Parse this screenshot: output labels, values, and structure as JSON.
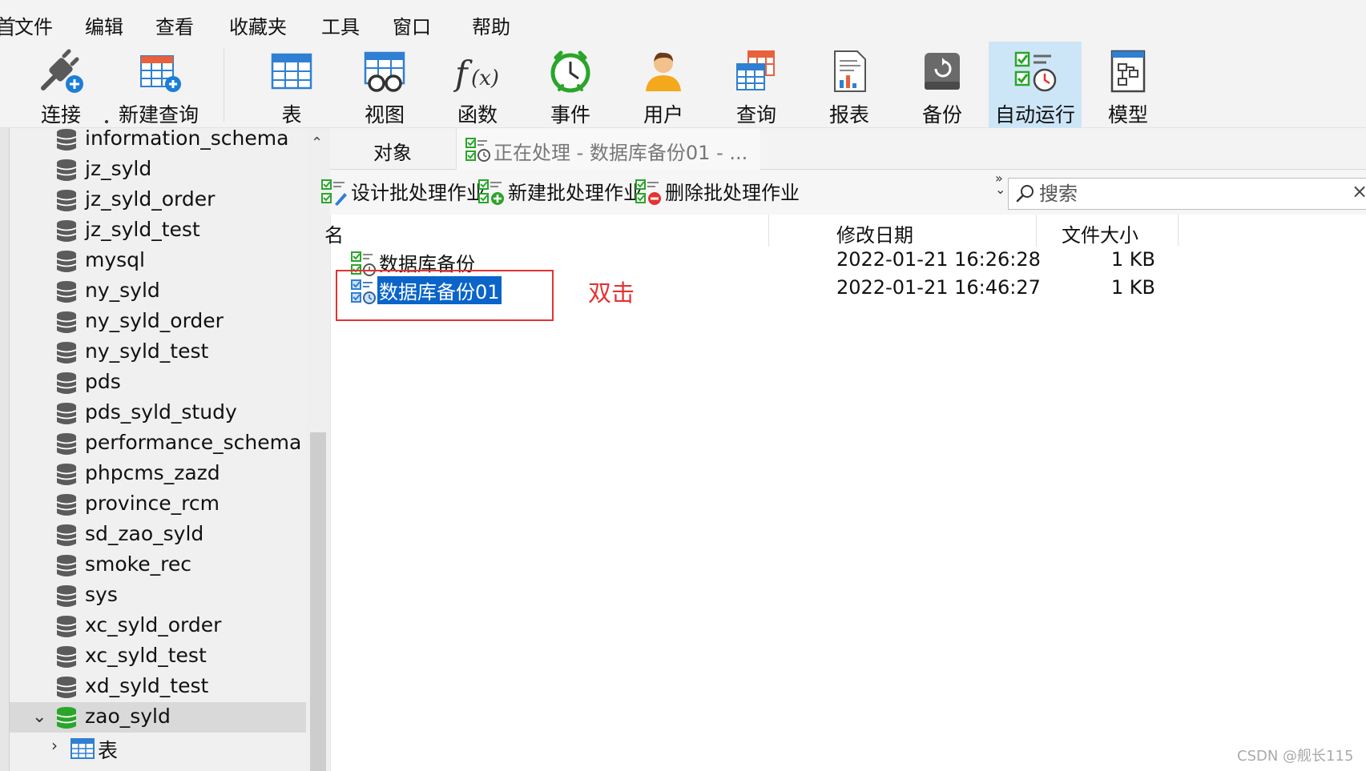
{
  "menu": {
    "edge_glyph": "首",
    "items": [
      "文件",
      "编辑",
      "查看",
      "收藏夹",
      "工具",
      "窗口",
      "帮助"
    ]
  },
  "toolbar": {
    "buttons": [
      {
        "label": "连接",
        "icon": "connect-plug-icon"
      },
      {
        "label": "新建查询",
        "icon": "new-query-icon"
      },
      {
        "label": "表",
        "icon": "table-icon"
      },
      {
        "label": "视图",
        "icon": "view-icon"
      },
      {
        "label": "函数",
        "icon": "function-icon"
      },
      {
        "label": "事件",
        "icon": "event-clock-icon"
      },
      {
        "label": "用户",
        "icon": "user-icon"
      },
      {
        "label": "查询",
        "icon": "query-icon"
      },
      {
        "label": "报表",
        "icon": "report-icon"
      },
      {
        "label": "备份",
        "icon": "backup-icon"
      },
      {
        "label": "自动运行",
        "icon": "automation-icon",
        "active": true
      },
      {
        "label": "模型",
        "icon": "model-icon"
      }
    ]
  },
  "tree": {
    "databases": [
      "information_schema",
      "jz_syld",
      "jz_syld_order",
      "jz_syld_test",
      "mysql",
      "ny_syld",
      "ny_syld_order",
      "ny_syld_test",
      "pds",
      "pds_syld_study",
      "performance_schema",
      "phpcms_zazd",
      "province_rcm",
      "sd_zao_syld",
      "smoke_rec",
      "sys",
      "xc_syld_order",
      "xc_syld_test",
      "xd_syld_test"
    ],
    "open_database": "zao_syld",
    "open_child": "表",
    "colors": {
      "db_gray": "#5b5b5b",
      "db_open": "#2aa52a"
    }
  },
  "tabs": {
    "objects": "对象",
    "processing": "正在处理 - 数据库备份01 - ..."
  },
  "object_toolbar": {
    "design": "设计批处理作业",
    "new": "新建批处理作业",
    "delete": "删除批处理作业",
    "more": "»",
    "search_placeholder": "搜索",
    "clear": "×"
  },
  "columns": {
    "name": "名",
    "modified": "修改日期",
    "size": "文件大小"
  },
  "rows": [
    {
      "name": "数据库备份",
      "modified": "2022-01-21 16:26:28",
      "size": "1 KB",
      "selected": false
    },
    {
      "name": "数据库备份01",
      "modified": "2022-01-21 16:46:27",
      "size": "1 KB",
      "selected": true
    }
  ],
  "annotation": {
    "text": "双击",
    "color": "#e53232"
  },
  "watermark": "CSDN @舰长115",
  "accent": "#0a64c9"
}
